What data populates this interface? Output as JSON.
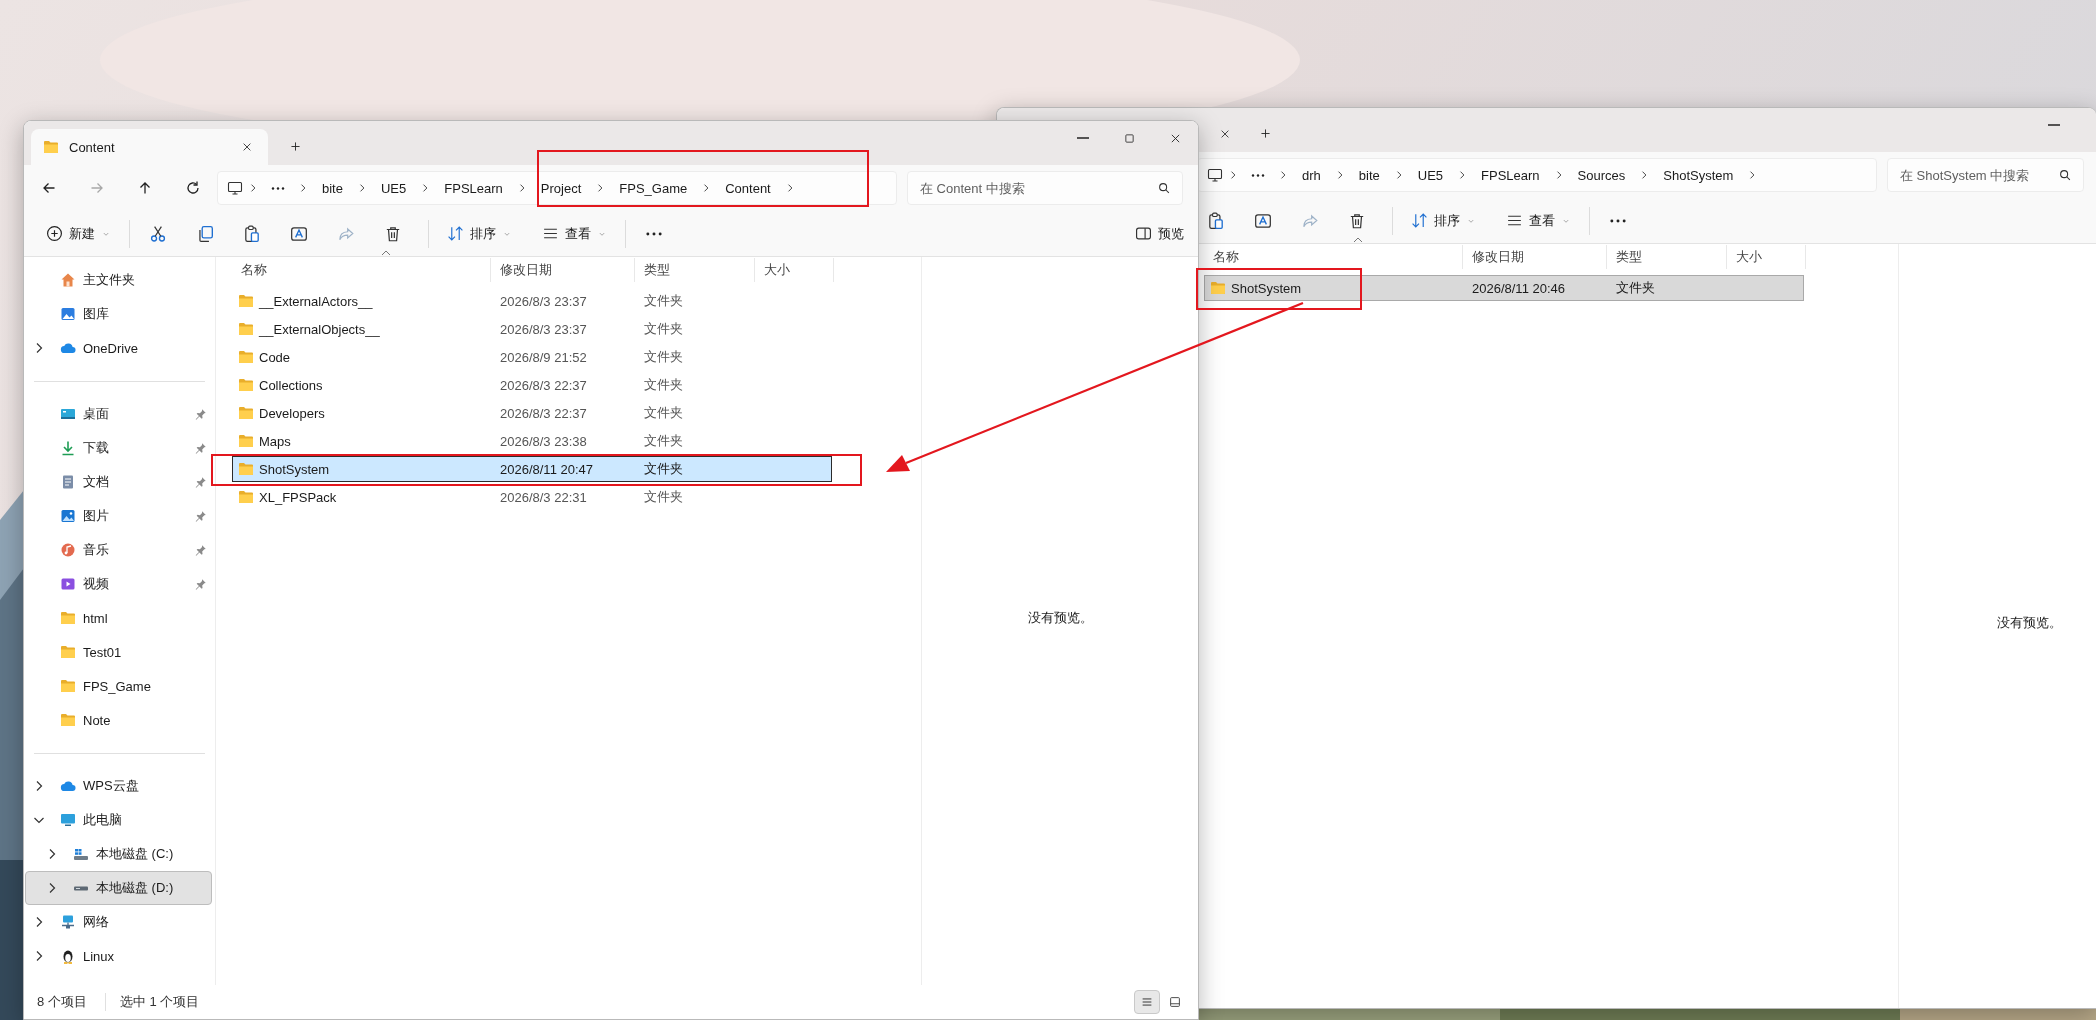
{
  "back_window": {
    "breadcrumbs": [
      "drh",
      "bite",
      "UE5",
      "FPSLearn",
      "Sources",
      "ShotSystem"
    ],
    "search_placeholder": "在 ShotSystem 中搜索",
    "toolbar": {
      "sort": "排序",
      "view": "查看"
    },
    "columns": [
      "名称",
      "修改日期",
      "类型",
      "大小"
    ],
    "rows": [
      {
        "name": "ShotSystem",
        "date": "2026/8/11 20:46",
        "type": "文件夹",
        "selected": true
      }
    ],
    "preview_text": "没有预览。"
  },
  "front_window": {
    "tab": {
      "title": "Content",
      "selected": true
    },
    "breadcrumbs": [
      "bite",
      "UE5",
      "FPSLearn",
      "Project",
      "FPS_Game",
      "Content"
    ],
    "search_placeholder": "在 Content 中搜索",
    "toolbar": {
      "new": "新建",
      "sort": "排序",
      "view": "查看",
      "details": "预览"
    },
    "sidebar": {
      "groups": [
        [
          {
            "label": "主文件夹",
            "kind": "home",
            "selected": false
          },
          {
            "label": "图库",
            "kind": "gallery",
            "selected": false
          },
          {
            "label": "OneDrive",
            "kind": "cloud",
            "selected": false,
            "expanded": false
          }
        ],
        [
          {
            "label": "桌面",
            "kind": "desktop",
            "selected": false,
            "pinned": true
          },
          {
            "label": "下载",
            "kind": "download",
            "selected": false,
            "pinned": true
          },
          {
            "label": "文档",
            "kind": "document",
            "selected": false,
            "pinned": true
          },
          {
            "label": "图片",
            "kind": "pictures",
            "selected": false,
            "pinned": true
          },
          {
            "label": "音乐",
            "kind": "music",
            "selected": false,
            "pinned": true
          },
          {
            "label": "视频",
            "kind": "video",
            "selected": false,
            "pinned": true
          },
          {
            "label": "html",
            "kind": "folder",
            "selected": false,
            "pinned": false
          },
          {
            "label": "Test01",
            "kind": "folder",
            "selected": false,
            "pinned": false
          },
          {
            "label": "FPS_Game",
            "kind": "folder",
            "selected": false,
            "pinned": false
          },
          {
            "label": "Note",
            "kind": "folder",
            "selected": false,
            "pinned": false
          }
        ],
        [
          {
            "label": "WPS云盘",
            "kind": "cloud",
            "selected": false,
            "expanded": false
          },
          {
            "label": "此电脑",
            "kind": "computer",
            "selected": false,
            "expanded": true,
            "children": [
              {
                "label": "本地磁盘 (C:)",
                "kind": "system_drive",
                "selected": false,
                "expanded": false
              },
              {
                "label": "本地磁盘 (D:)",
                "kind": "drive",
                "selected": true,
                "expanded": false
              }
            ]
          },
          {
            "label": "网络",
            "kind": "network",
            "selected": false,
            "expanded": false
          },
          {
            "label": "Linux",
            "kind": "linux",
            "selected": false,
            "expanded": false
          }
        ]
      ]
    },
    "columns": [
      "名称",
      "修改日期",
      "类型",
      "大小"
    ],
    "rows": [
      {
        "name": "__ExternalActors__",
        "date": "2026/8/3 23:37",
        "type": "文件夹",
        "selected": false
      },
      {
        "name": "__ExternalObjects__",
        "date": "2026/8/3 23:37",
        "type": "文件夹",
        "selected": false
      },
      {
        "name": "Code",
        "date": "2026/8/9 21:52",
        "type": "文件夹",
        "selected": false
      },
      {
        "name": "Collections",
        "date": "2026/8/3 22:37",
        "type": "文件夹",
        "selected": false
      },
      {
        "name": "Developers",
        "date": "2026/8/3 22:37",
        "type": "文件夹",
        "selected": false
      },
      {
        "name": "Maps",
        "date": "2026/8/3 23:38",
        "type": "文件夹",
        "selected": false
      },
      {
        "name": "ShotSystem",
        "date": "2026/8/11 20:47",
        "type": "文件夹",
        "selected": true
      },
      {
        "name": "XL_FPSPack",
        "date": "2026/8/3 22:31",
        "type": "文件夹",
        "selected": false
      }
    ],
    "preview_text": "没有预览。",
    "status": {
      "items": "8 个项目",
      "selection": "选中 1 个项目",
      "views": [
        {
          "kind": "details",
          "selected": true
        },
        {
          "kind": "tiles",
          "selected": false
        }
      ]
    }
  }
}
